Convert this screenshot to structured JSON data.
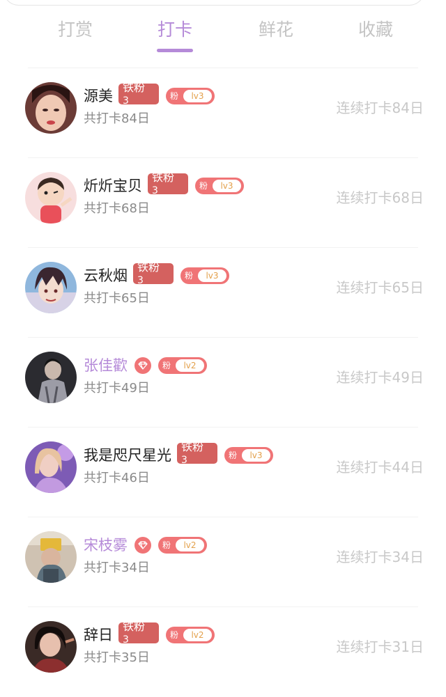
{
  "tabs": [
    "打赏",
    "打卡",
    "鲜花",
    "收藏"
  ],
  "active_tab": "打卡",
  "colors": {
    "accent": "#b58ad8",
    "fan_badge": "#d4615f",
    "level_badge": "#f07476",
    "muted_text": "#c8c8c8"
  },
  "fan_badge": {
    "title": "铁粉",
    "level": "3"
  },
  "level_prefix": "粉",
  "diamond_icon": "diamond-icon",
  "checkins": [
    {
      "name": "源美",
      "fan_badge": true,
      "level": "lv3",
      "total": "共打卡84日",
      "streak": "连续打卡84日",
      "name_highlight": false
    },
    {
      "name": "炘炘宝贝",
      "fan_badge": true,
      "level": "lv3",
      "total": "共打卡68日",
      "streak": "连续打卡68日",
      "name_highlight": false
    },
    {
      "name": "云秋烟",
      "fan_badge": true,
      "level": "lv3",
      "total": "共打卡65日",
      "streak": "连续打卡65日",
      "name_highlight": false
    },
    {
      "name": "张佳歡",
      "fan_badge": false,
      "level": "lv2",
      "total": "共打卡49日",
      "streak": "连续打卡49日",
      "name_highlight": true
    },
    {
      "name": "我是咫尺星光",
      "fan_badge": true,
      "level": "lv3",
      "total": "共打卡46日",
      "streak": "连续打卡44日",
      "name_highlight": false
    },
    {
      "name": "宋枝雾",
      "fan_badge": false,
      "level": "lv2",
      "total": "共打卡34日",
      "streak": "连续打卡34日",
      "name_highlight": true
    },
    {
      "name": "辞日",
      "fan_badge": true,
      "level": "lv2",
      "total": "共打卡35日",
      "streak": "连续打卡31日",
      "name_highlight": false
    }
  ]
}
